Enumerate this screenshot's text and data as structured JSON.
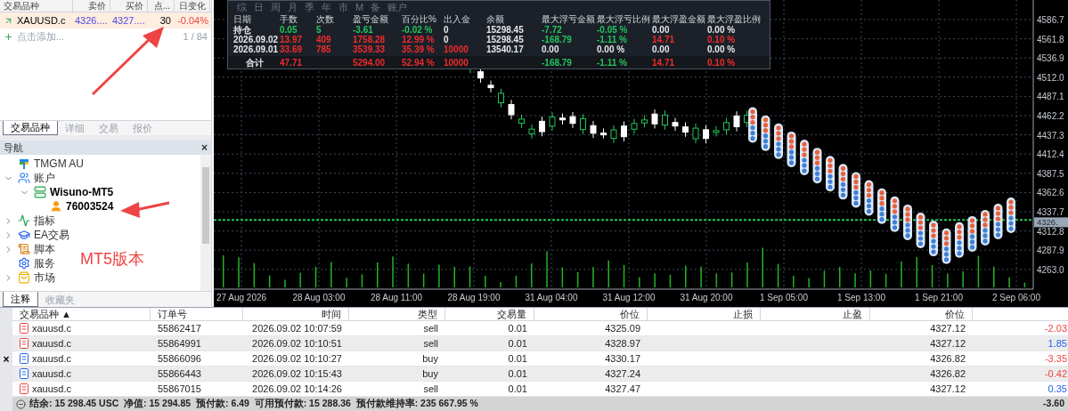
{
  "market_watch": {
    "columns": [
      "交易品种",
      "卖价",
      "买价",
      "点...",
      "日变化"
    ],
    "rows": [
      {
        "symbol": "XAUUSD.c",
        "bid": "4326....",
        "ask": "4327....",
        "points": "30",
        "change": "-0.04%"
      }
    ],
    "add_label": "点击添加...",
    "count": "1 / 84",
    "tabs": [
      {
        "label": "交易品种",
        "selected": true
      },
      {
        "label": "详细",
        "selected": false
      },
      {
        "label": "交易",
        "selected": false
      },
      {
        "label": "报价",
        "selected": false
      }
    ]
  },
  "navigator": {
    "title": "导航",
    "close": "×",
    "items": [
      {
        "label": "TMGM AU",
        "kind": "broker"
      },
      {
        "label": "账户",
        "kind": "accounts",
        "expanded": true,
        "children": [
          {
            "label": "Wisuno-MT5",
            "kind": "server",
            "expanded": true,
            "children": [
              {
                "label": "76003524",
                "kind": "account"
              }
            ]
          }
        ]
      },
      {
        "label": "指标",
        "kind": "indicators",
        "expanded": false
      },
      {
        "label": "EA交易",
        "kind": "experts",
        "expanded": false
      },
      {
        "label": "脚本",
        "kind": "scripts",
        "expanded": false
      },
      {
        "label": "服务",
        "kind": "services"
      },
      {
        "label": "市场",
        "kind": "market",
        "expanded": false
      }
    ],
    "annotation": "MT5版本",
    "tabs": [
      {
        "label": "注释",
        "selected": true
      },
      {
        "label": "收藏夹",
        "selected": false
      }
    ]
  },
  "stats_panel": {
    "periods": [
      "综",
      "日",
      "周",
      "月",
      "季",
      "年",
      "市",
      "M",
      "备",
      "账户"
    ],
    "columns": [
      "日期",
      "手数",
      "次数",
      "盈亏金额",
      "百分比%",
      "出入金",
      "余额",
      "最大浮亏金额",
      "最大浮亏比例",
      "最大浮盈金额",
      "最大浮盈比例"
    ],
    "rows": [
      {
        "kind": "row",
        "cells": [
          {
            "text": "持仓",
            "color": "#e5e7eb"
          },
          {
            "text": "0.05",
            "color": "#22c55e"
          },
          {
            "text": "5",
            "color": "#22c55e"
          },
          {
            "text": "-3.61",
            "color": "#22c55e"
          },
          {
            "text": "-0.02 %",
            "color": "#22c55e"
          },
          {
            "text": "0",
            "color": "#e5e7eb"
          },
          {
            "text": "15298.45",
            "color": "#e5e7eb"
          },
          {
            "text": "-7.72",
            "color": "#22c55e"
          },
          {
            "text": "-0.05 %",
            "color": "#22c55e"
          },
          {
            "text": "0.00",
            "color": "#e5e7eb"
          },
          {
            "text": "0.00 %",
            "color": "#e5e7eb"
          }
        ]
      },
      {
        "kind": "row",
        "cells": [
          {
            "text": "2026.09.02",
            "color": "#e5e7eb"
          },
          {
            "text": "13.97",
            "color": "#ef2b2b"
          },
          {
            "text": "409",
            "color": "#ef2b2b"
          },
          {
            "text": "1758.28",
            "color": "#ef2b2b"
          },
          {
            "text": "12.99 %",
            "color": "#ef2b2b"
          },
          {
            "text": "0",
            "color": "#e5e7eb"
          },
          {
            "text": "15298.45",
            "color": "#e5e7eb"
          },
          {
            "text": "-168.79",
            "color": "#22c55e"
          },
          {
            "text": "-1.11 %",
            "color": "#22c55e"
          },
          {
            "text": "14.71",
            "color": "#ef2b2b"
          },
          {
            "text": "0.10 %",
            "color": "#ef2b2b"
          }
        ]
      },
      {
        "kind": "row",
        "cells": [
          {
            "text": "2026.09.01",
            "color": "#e5e7eb"
          },
          {
            "text": "33.69",
            "color": "#ef2b2b"
          },
          {
            "text": "785",
            "color": "#ef2b2b"
          },
          {
            "text": "3539.33",
            "color": "#ef2b2b"
          },
          {
            "text": "35.39 %",
            "color": "#ef2b2b"
          },
          {
            "text": "10000",
            "color": "#ef2b2b"
          },
          {
            "text": "13540.17",
            "color": "#e5e7eb"
          },
          {
            "text": "0.00",
            "color": "#e5e7eb"
          },
          {
            "text": "0.00 %",
            "color": "#e5e7eb"
          },
          {
            "text": "0.00",
            "color": "#e5e7eb"
          },
          {
            "text": "0.00 %",
            "color": "#e5e7eb"
          }
        ]
      },
      {
        "kind": "total",
        "cells": [
          {
            "text": "合计",
            "color": "#e5e7eb"
          },
          {
            "text": "47.71",
            "color": "#ef2b2b"
          },
          null,
          {
            "text": "5294.00",
            "color": "#ef2b2b"
          },
          {
            "text": "52.94 %",
            "color": "#ef2b2b"
          },
          {
            "text": "10000",
            "color": "#ef2b2b"
          },
          null,
          {
            "text": "-168.79",
            "color": "#22c55e"
          },
          {
            "text": "-1.11 %",
            "color": "#22c55e"
          },
          {
            "text": "14.71",
            "color": "#ef2b2b"
          },
          {
            "text": "0.10 %",
            "color": "#ef2b2b"
          }
        ]
      }
    ]
  },
  "chart": {
    "price_axis": [
      "4586.7",
      "4561.8",
      "4536.9",
      "4512.0",
      "4487.1",
      "4462.2",
      "4437.3",
      "4412.4",
      "4387.5",
      "4362.6",
      "4337.7",
      "4312.8",
      "4287.9",
      "4263.0"
    ],
    "current_price": "4326.",
    "time_axis": [
      "27 Aug 2026",
      "28 Aug 03:00",
      "28 Aug 11:00",
      "28 Aug 19:00",
      "31 Aug 04:00",
      "31 Aug 12:00",
      "31 Aug 20:00",
      "1 Sep 05:00",
      "1 Sep 13:00",
      "1 Sep 21:00",
      "2 Sep 06:00"
    ]
  },
  "terminal": {
    "close": "×",
    "columns": [
      "交易品种 ▲",
      "订单号",
      "时间",
      "类型",
      "交易量",
      "价位",
      "止损",
      "止盈",
      "价位"
    ],
    "rows": [
      {
        "kind": "sell",
        "symbol": "xauusd.c",
        "order": "55862417",
        "time": "2026.09.02 10:07:59",
        "type": "sell",
        "volume": "0.01",
        "price": "4325.09",
        "current": "4327.12",
        "profit": "-2.03",
        "color": "#ef4444"
      },
      {
        "kind": "sell",
        "symbol": "xauusd.c",
        "order": "55864991",
        "time": "2026.09.02 10:10:51",
        "type": "sell",
        "volume": "0.01",
        "price": "4328.97",
        "current": "4327.12",
        "profit": "1.85",
        "color": "#2563eb"
      },
      {
        "kind": "buy",
        "symbol": "xauusd.c",
        "order": "55866096",
        "time": "2026.09.02 10:10:27",
        "type": "buy",
        "volume": "0.01",
        "price": "4330.17",
        "current": "4326.82",
        "profit": "-3.35",
        "color": "#ef4444"
      },
      {
        "kind": "buy",
        "symbol": "xauusd.c",
        "order": "55866443",
        "time": "2026.09.02 10:15:43",
        "type": "buy",
        "volume": "0.01",
        "price": "4327.24",
        "current": "4326.82",
        "profit": "-0.42",
        "color": "#ef4444"
      },
      {
        "kind": "sell",
        "symbol": "xauusd.c",
        "order": "55867015",
        "time": "2026.09.02 10:14:26",
        "type": "sell",
        "volume": "0.01",
        "price": "4327.47",
        "current": "4327.12",
        "profit": "0.35",
        "color": "#2563eb"
      }
    ],
    "summary": "结余: 15 298.45 USC  净值: 15 294.85  预付款: 6.49  可用预付款: 15 288.36  预付款维持率: 235 667.95 %",
    "total": "-3.60"
  }
}
